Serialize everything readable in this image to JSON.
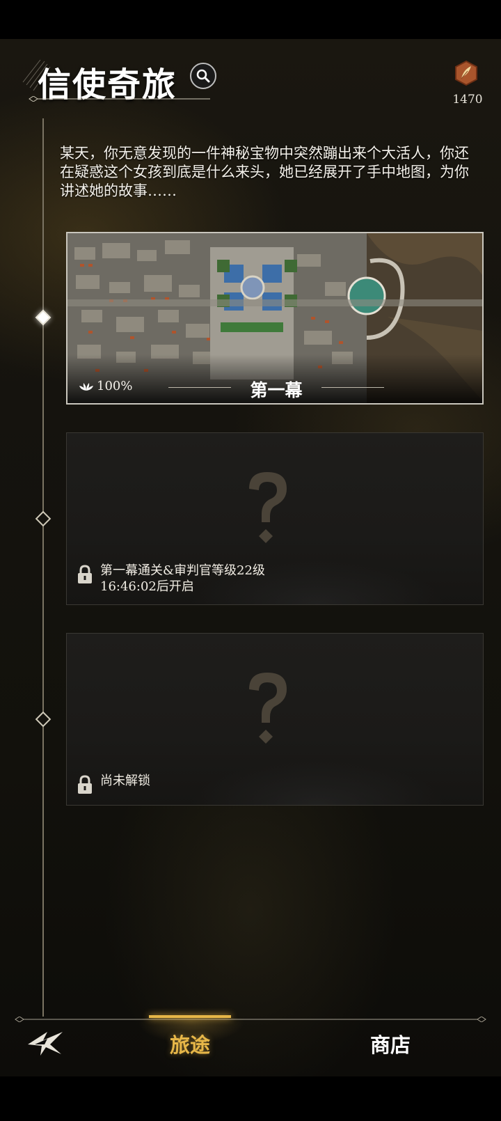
{
  "header": {
    "title": "信使奇旅",
    "search_icon": "search-icon",
    "currency_icon": "feather-badge-icon",
    "currency_value": "1470"
  },
  "intro": {
    "text": "某天，你无意发现的一件神秘宝物中突然蹦出来个大活人，你还在疑惑这个女孩到底是什么来头，她已经展开了手中地图，为你讲述她的故事……"
  },
  "acts": [
    {
      "title": "第一幕",
      "progress": "100%",
      "progress_icon": "lotus-icon",
      "state": "unlocked"
    },
    {
      "lock_line1": "第一幕通关&审判官等级22级",
      "lock_line2": "16:46:02后开启",
      "state": "locked"
    },
    {
      "lock_line1": "尚未解锁",
      "state": "locked"
    }
  ],
  "nav": {
    "tabs": [
      {
        "label": "旅途",
        "active": true
      },
      {
        "label": "商店",
        "active": false
      }
    ],
    "logo_icon": "emblem-icon"
  },
  "colors": {
    "accent": "#e6b648",
    "background": "#15130e",
    "text": "#f4f1ea"
  }
}
